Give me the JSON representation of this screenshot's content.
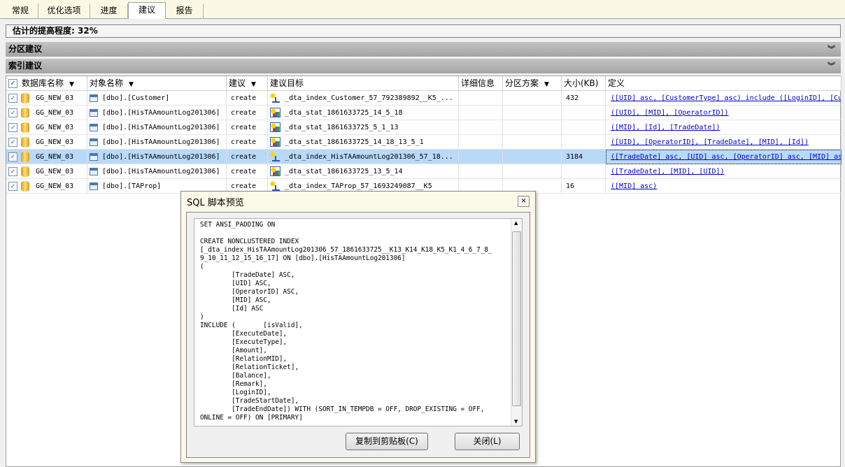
{
  "tabs": [
    "常规",
    "优化选项",
    "进度",
    "建议",
    "报告"
  ],
  "active_tab": "建议",
  "improvement": {
    "label": "估计的提高程度:",
    "value": "32%"
  },
  "sections": {
    "partition": "分区建议",
    "index": "索引建议"
  },
  "columns": [
    "数据库名称",
    "对象名称",
    "建议",
    "建议目标",
    "详细信息",
    "分区方案",
    "大小(KB)",
    "定义"
  ],
  "rows": [
    {
      "db": "GG_NEW_03",
      "object": "[dbo].[Customer]",
      "action": "create",
      "target_type": "index",
      "target": "_dta_index_Customer_57_792389892__K5_...",
      "details": "",
      "partition": "",
      "size": "432",
      "definition": "([UID] asc, [CustomerType] asc) include ([LoginID], [Cu"
    },
    {
      "db": "GG_NEW_03",
      "object": "[dbo].[HisTAAmountLog201306]",
      "action": "create",
      "target_type": "stat",
      "target": "_dta_stat_1861633725_14_5_18",
      "details": "",
      "partition": "",
      "size": "",
      "definition": "([UID], [MID], [OperatorID])"
    },
    {
      "db": "GG_NEW_03",
      "object": "[dbo].[HisTAAmountLog201306]",
      "action": "create",
      "target_type": "stat",
      "target": "_dta_stat_1861633725_5_1_13",
      "details": "",
      "partition": "",
      "size": "",
      "definition": "([MID], [Id], [TradeDate])"
    },
    {
      "db": "GG_NEW_03",
      "object": "[dbo].[HisTAAmountLog201306]",
      "action": "create",
      "target_type": "stat",
      "target": "_dta_stat_1861633725_14_18_13_5_1",
      "details": "",
      "partition": "",
      "size": "",
      "definition": "([UID], [OperatorID], [TradeDate], [MID], [Id])"
    },
    {
      "db": "GG_NEW_03",
      "object": "[dbo].[HisTAAmountLog201306]",
      "action": "create",
      "target_type": "index",
      "target": "_dta_index_HisTAAmountLog201306_57_18...",
      "details": "",
      "partition": "",
      "size": "3184",
      "definition": "([TradeDate] asc, [UID] asc, [OperatorID] asc, [MID] as",
      "selected": true
    },
    {
      "db": "GG_NEW_03",
      "object": "[dbo].[HisTAAmountLog201306]",
      "action": "create",
      "target_type": "stat",
      "target": "_dta_stat_1861633725_13_5_14",
      "details": "",
      "partition": "",
      "size": "",
      "definition": "([TradeDate], [MID], [UID])"
    },
    {
      "db": "GG_NEW_03",
      "object": "[dbo].[TAProp]",
      "action": "create",
      "target_type": "index",
      "target": "_dta_index_TAProp_57_1693249087__K5",
      "details": "",
      "partition": "",
      "size": "16",
      "definition": "([MID] asc)"
    }
  ],
  "dialog": {
    "title": "SQL 脚本预览",
    "sql": "SET ANSI_PADDING ON\n\nCREATE NONCLUSTERED INDEX\n[_dta_index_HisTAAmountLog201306_57_1861633725__K13_K14_K18_K5_K1_4_6_7_8_\n9_10_11_12_15_16_17] ON [dbo].[HisTAAmountLog201306]\n(\n        [TradeDate] ASC,\n        [UID] ASC,\n        [OperatorID] ASC,\n        [MID] ASC,\n        [Id] ASC\n)\nINCLUDE (       [isValid],\n        [ExecuteDate],\n        [ExecuteType],\n        [Amount],\n        [RelationMID],\n        [RelationTicket],\n        [Balance],\n        [Remark],\n        [LoginID],\n        [TradeStartDate],\n        [TradeEndDate]) WITH (SORT_IN_TEMPDB = OFF, DROP_EXISTING = OFF,\nONLINE = OFF) ON [PRIMARY]",
    "copy_button": "复制到剪贴板(C)",
    "close_button": "关闭(L)"
  }
}
